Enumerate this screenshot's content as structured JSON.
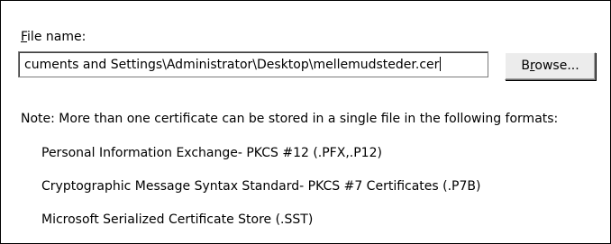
{
  "file_name": {
    "label_mnemonic": "F",
    "label_rest": "ile name:",
    "value": "cuments and Settings\\Administrator\\Desktop\\mellemudsteder.cer"
  },
  "browse_button": {
    "label_before": "B",
    "label_mnemonic": "r",
    "label_after": "owse..."
  },
  "note": {
    "text": "Note:  More than one certificate can be stored in a single file in the following formats:"
  },
  "formats": [
    "Personal Information Exchange- PKCS #12 (.PFX,.P12)",
    "Cryptographic Message Syntax Standard- PKCS #7 Certificates (.P7B)",
    "Microsoft Serialized Certificate Store (.SST)"
  ]
}
